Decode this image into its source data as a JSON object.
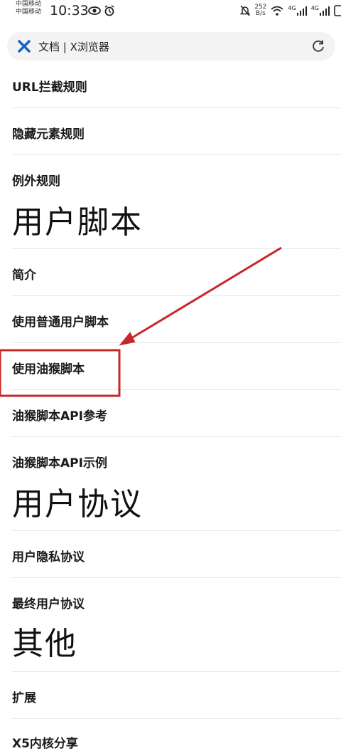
{
  "status_bar": {
    "carrier_1": "中国移动",
    "carrier_2": "中国移动",
    "time": "10:33",
    "net_speed_value": "252",
    "net_speed_unit": "B/s",
    "signal_1_label": "4G",
    "signal_2_label": "4G",
    "icons": [
      "eye-icon",
      "alarm-icon",
      "mute-icon",
      "wifi-icon",
      "signal-icon",
      "signal-icon",
      "battery-icon"
    ]
  },
  "address_bar": {
    "title": "文档 | X浏览器",
    "logo_icon": "x-browser-logo-icon",
    "refresh_icon": "refresh-icon",
    "logo_color": "#1565c0"
  },
  "doc": {
    "items": [
      {
        "label": "URL拦截规则"
      },
      {
        "label": "隐藏元素规则"
      },
      {
        "label": "例外规则"
      },
      {
        "label": "简介"
      },
      {
        "label": "使用普通用户脚本"
      },
      {
        "label": "使用油猴脚本"
      },
      {
        "label": "油猴脚本API参考"
      },
      {
        "label": "油猴脚本API示例"
      },
      {
        "label": "用户隐私协议"
      },
      {
        "label": "最终用户协议"
      },
      {
        "label": "扩展"
      },
      {
        "label": "X5内核分享"
      }
    ],
    "headings": [
      {
        "label": "用户脚本"
      },
      {
        "label": "用户协议"
      },
      {
        "label": "其他"
      }
    ]
  },
  "annotation": {
    "color": "#c62828",
    "target": "使用油猴脚本"
  }
}
